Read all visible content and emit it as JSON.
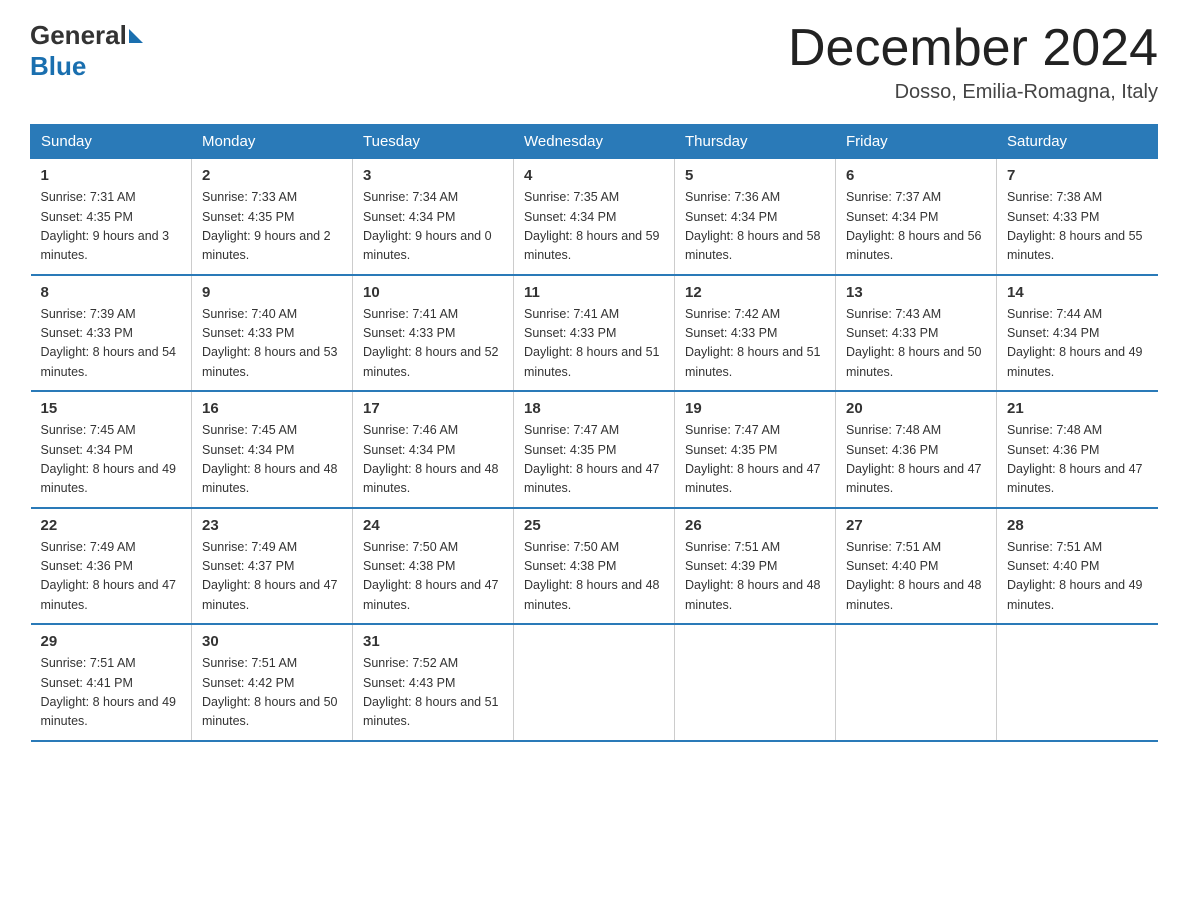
{
  "header": {
    "logo_general": "General",
    "logo_blue": "Blue",
    "month_title": "December 2024",
    "location": "Dosso, Emilia-Romagna, Italy"
  },
  "days_of_week": [
    "Sunday",
    "Monday",
    "Tuesday",
    "Wednesday",
    "Thursday",
    "Friday",
    "Saturday"
  ],
  "weeks": [
    [
      {
        "day": "1",
        "sunrise": "7:31 AM",
        "sunset": "4:35 PM",
        "daylight": "9 hours and 3 minutes."
      },
      {
        "day": "2",
        "sunrise": "7:33 AM",
        "sunset": "4:35 PM",
        "daylight": "9 hours and 2 minutes."
      },
      {
        "day": "3",
        "sunrise": "7:34 AM",
        "sunset": "4:34 PM",
        "daylight": "9 hours and 0 minutes."
      },
      {
        "day": "4",
        "sunrise": "7:35 AM",
        "sunset": "4:34 PM",
        "daylight": "8 hours and 59 minutes."
      },
      {
        "day": "5",
        "sunrise": "7:36 AM",
        "sunset": "4:34 PM",
        "daylight": "8 hours and 58 minutes."
      },
      {
        "day": "6",
        "sunrise": "7:37 AM",
        "sunset": "4:34 PM",
        "daylight": "8 hours and 56 minutes."
      },
      {
        "day": "7",
        "sunrise": "7:38 AM",
        "sunset": "4:33 PM",
        "daylight": "8 hours and 55 minutes."
      }
    ],
    [
      {
        "day": "8",
        "sunrise": "7:39 AM",
        "sunset": "4:33 PM",
        "daylight": "8 hours and 54 minutes."
      },
      {
        "day": "9",
        "sunrise": "7:40 AM",
        "sunset": "4:33 PM",
        "daylight": "8 hours and 53 minutes."
      },
      {
        "day": "10",
        "sunrise": "7:41 AM",
        "sunset": "4:33 PM",
        "daylight": "8 hours and 52 minutes."
      },
      {
        "day": "11",
        "sunrise": "7:41 AM",
        "sunset": "4:33 PM",
        "daylight": "8 hours and 51 minutes."
      },
      {
        "day": "12",
        "sunrise": "7:42 AM",
        "sunset": "4:33 PM",
        "daylight": "8 hours and 51 minutes."
      },
      {
        "day": "13",
        "sunrise": "7:43 AM",
        "sunset": "4:33 PM",
        "daylight": "8 hours and 50 minutes."
      },
      {
        "day": "14",
        "sunrise": "7:44 AM",
        "sunset": "4:34 PM",
        "daylight": "8 hours and 49 minutes."
      }
    ],
    [
      {
        "day": "15",
        "sunrise": "7:45 AM",
        "sunset": "4:34 PM",
        "daylight": "8 hours and 49 minutes."
      },
      {
        "day": "16",
        "sunrise": "7:45 AM",
        "sunset": "4:34 PM",
        "daylight": "8 hours and 48 minutes."
      },
      {
        "day": "17",
        "sunrise": "7:46 AM",
        "sunset": "4:34 PM",
        "daylight": "8 hours and 48 minutes."
      },
      {
        "day": "18",
        "sunrise": "7:47 AM",
        "sunset": "4:35 PM",
        "daylight": "8 hours and 47 minutes."
      },
      {
        "day": "19",
        "sunrise": "7:47 AM",
        "sunset": "4:35 PM",
        "daylight": "8 hours and 47 minutes."
      },
      {
        "day": "20",
        "sunrise": "7:48 AM",
        "sunset": "4:36 PM",
        "daylight": "8 hours and 47 minutes."
      },
      {
        "day": "21",
        "sunrise": "7:48 AM",
        "sunset": "4:36 PM",
        "daylight": "8 hours and 47 minutes."
      }
    ],
    [
      {
        "day": "22",
        "sunrise": "7:49 AM",
        "sunset": "4:36 PM",
        "daylight": "8 hours and 47 minutes."
      },
      {
        "day": "23",
        "sunrise": "7:49 AM",
        "sunset": "4:37 PM",
        "daylight": "8 hours and 47 minutes."
      },
      {
        "day": "24",
        "sunrise": "7:50 AM",
        "sunset": "4:38 PM",
        "daylight": "8 hours and 47 minutes."
      },
      {
        "day": "25",
        "sunrise": "7:50 AM",
        "sunset": "4:38 PM",
        "daylight": "8 hours and 48 minutes."
      },
      {
        "day": "26",
        "sunrise": "7:51 AM",
        "sunset": "4:39 PM",
        "daylight": "8 hours and 48 minutes."
      },
      {
        "day": "27",
        "sunrise": "7:51 AM",
        "sunset": "4:40 PM",
        "daylight": "8 hours and 48 minutes."
      },
      {
        "day": "28",
        "sunrise": "7:51 AM",
        "sunset": "4:40 PM",
        "daylight": "8 hours and 49 minutes."
      }
    ],
    [
      {
        "day": "29",
        "sunrise": "7:51 AM",
        "sunset": "4:41 PM",
        "daylight": "8 hours and 49 minutes."
      },
      {
        "day": "30",
        "sunrise": "7:51 AM",
        "sunset": "4:42 PM",
        "daylight": "8 hours and 50 minutes."
      },
      {
        "day": "31",
        "sunrise": "7:52 AM",
        "sunset": "4:43 PM",
        "daylight": "8 hours and 51 minutes."
      },
      null,
      null,
      null,
      null
    ]
  ]
}
